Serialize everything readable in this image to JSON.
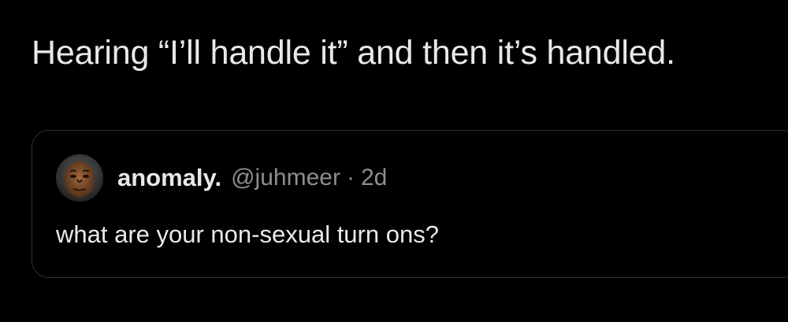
{
  "post": {
    "text": "Hearing “I’ll handle it” and then it’s handled."
  },
  "quoted_post": {
    "avatar_icon": "user-avatar-icon",
    "display_name": "anomaly.",
    "handle": "@juhmeer",
    "separator": "·",
    "time": "2d",
    "text": "what are your non-sexual turn ons?"
  },
  "colors": {
    "background": "#000000",
    "primary_text": "#e9e9e9",
    "secondary_text": "#8b8f93",
    "card_border": "#2f3336"
  }
}
